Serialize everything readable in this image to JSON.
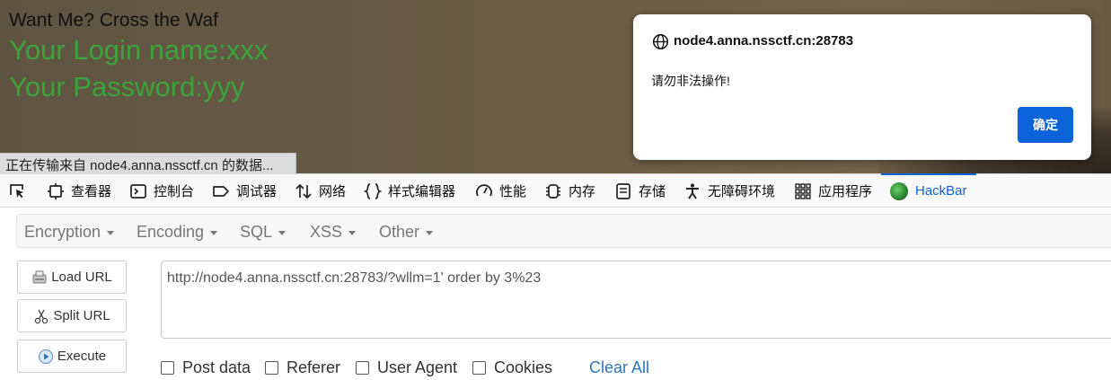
{
  "page": {
    "heading": "Want Me? Cross the Waf",
    "login_line": "Your Login name:xxx",
    "password_line": "Your Password:yyy",
    "status_text": "正在传输来自 node4.anna.nssctf.cn 的数据..."
  },
  "alert": {
    "origin": "node4.anna.nssctf.cn:28783",
    "message": "请勿非法操作!",
    "ok_label": "确定"
  },
  "devtools": {
    "tabs": [
      {
        "label": "查看器",
        "icon": "inspector-icon"
      },
      {
        "label": "控制台",
        "icon": "console-icon"
      },
      {
        "label": "调试器",
        "icon": "debugger-icon"
      },
      {
        "label": "网络",
        "icon": "network-icon"
      },
      {
        "label": "样式编辑器",
        "icon": "style-editor-icon"
      },
      {
        "label": "性能",
        "icon": "performance-icon"
      },
      {
        "label": "内存",
        "icon": "memory-icon"
      },
      {
        "label": "存储",
        "icon": "storage-icon"
      },
      {
        "label": "无障碍环境",
        "icon": "accessibility-icon"
      },
      {
        "label": "应用程序",
        "icon": "application-icon"
      },
      {
        "label": "HackBar",
        "icon": "hackbar-icon"
      }
    ],
    "active_tab": "HackBar",
    "accent_color": "#0a63d8"
  },
  "hackbar": {
    "menus": [
      "Encryption",
      "Encoding",
      "SQL",
      "XSS",
      "Other"
    ],
    "buttons": {
      "load_url": "Load URL",
      "split_url": "Split URL",
      "execute": "Execute"
    },
    "url_value": "http://node4.anna.nssctf.cn:28783/?wllm=1' order by 3%23",
    "options": {
      "post_data": "Post data",
      "referer": "Referer",
      "user_agent": "User Agent",
      "cookies": "Cookies"
    },
    "clear_all": "Clear All"
  }
}
